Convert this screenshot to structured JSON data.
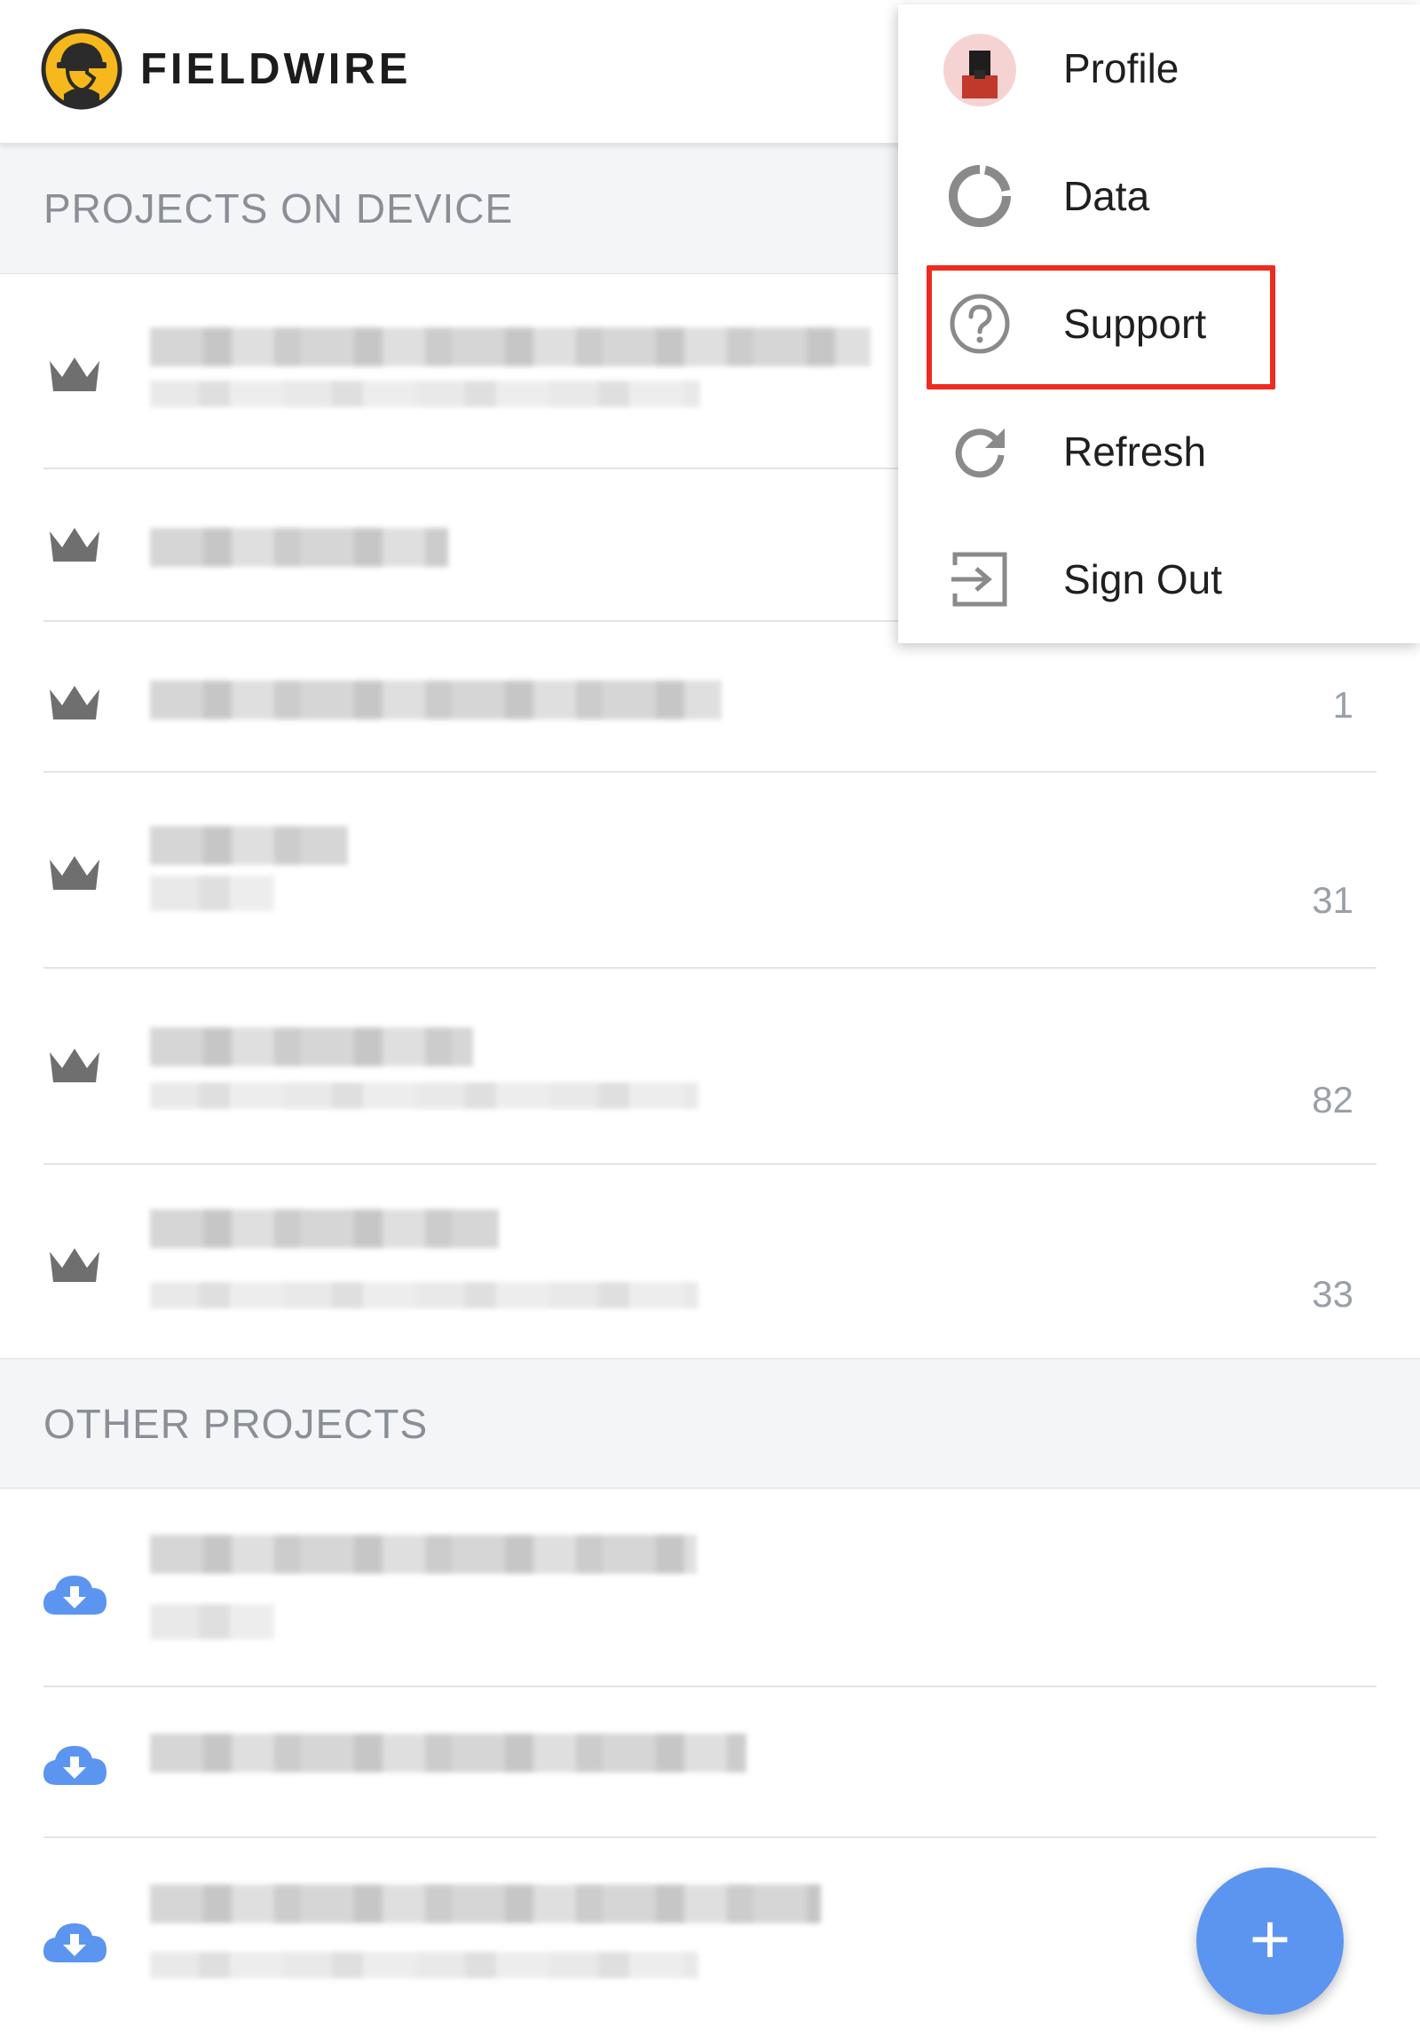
{
  "header": {
    "brand": "FIELDWIRE"
  },
  "sections": {
    "on_device": {
      "title": "PROJECTS ON DEVICE"
    },
    "other": {
      "title": "OTHER PROJECTS"
    }
  },
  "device_projects": [
    {
      "count": ""
    },
    {
      "count": ""
    },
    {
      "count": "1"
    },
    {
      "count": "31"
    },
    {
      "count": "82"
    },
    {
      "count": "33"
    }
  ],
  "menu": {
    "items": [
      {
        "label": "Profile",
        "icon": "avatar"
      },
      {
        "label": "Data",
        "icon": "data-ring-icon"
      },
      {
        "label": "Support",
        "icon": "help-circle-icon"
      },
      {
        "label": "Refresh",
        "icon": "refresh-icon"
      },
      {
        "label": "Sign Out",
        "icon": "sign-out-icon"
      }
    ],
    "highlighted": "Support"
  },
  "fab": {
    "label": "+"
  },
  "colors": {
    "accent": "#5b95f0",
    "highlight": "#ee2b1f",
    "logo": "#f6b81c"
  }
}
